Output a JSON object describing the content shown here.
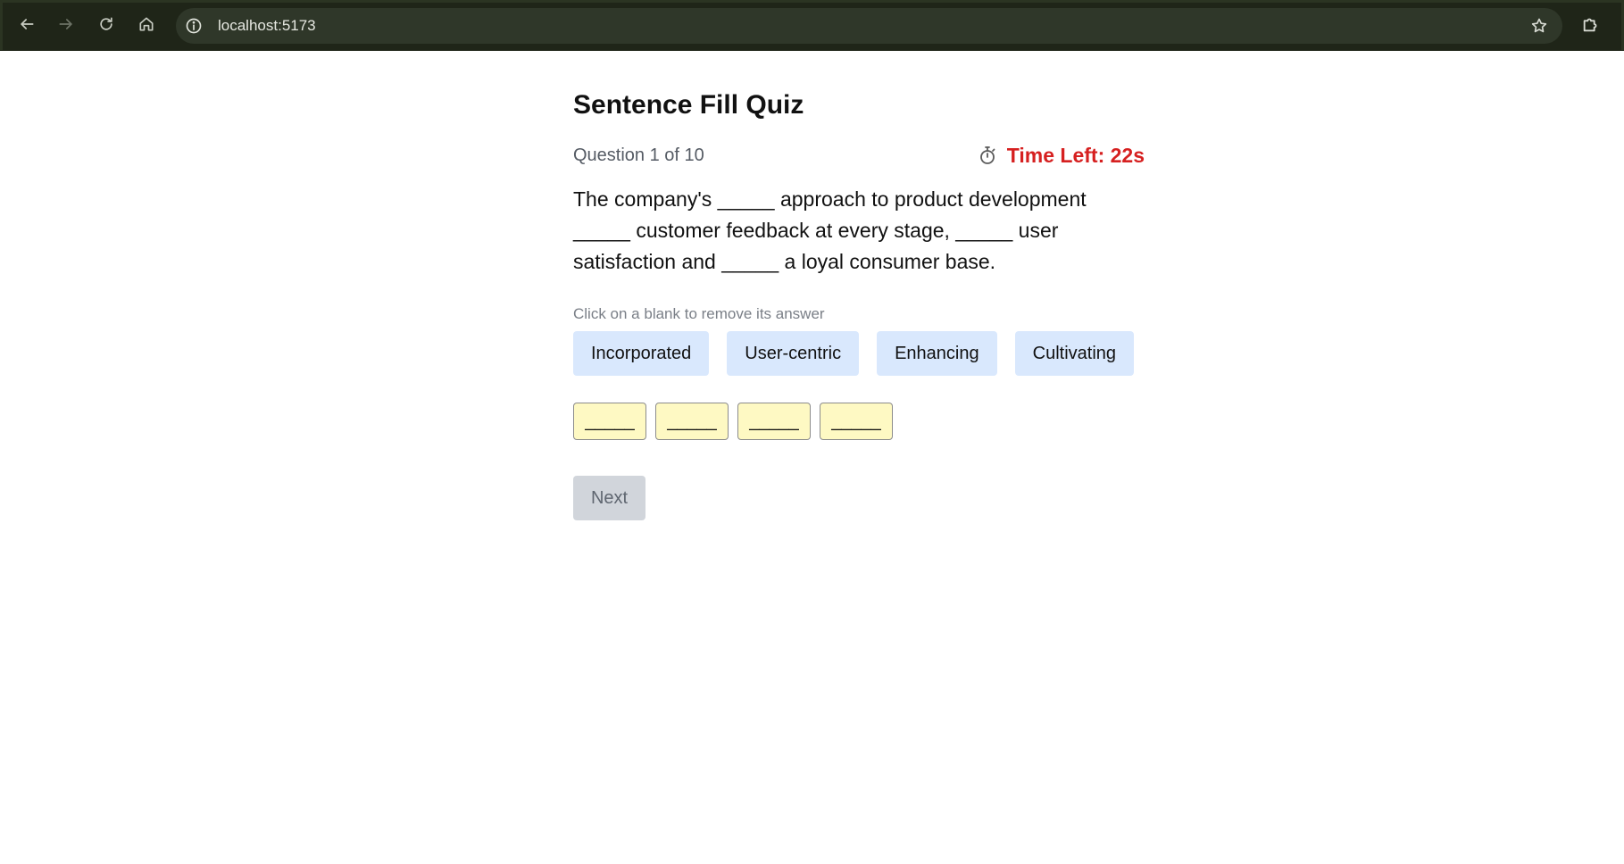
{
  "browser": {
    "url": "localhost:5173",
    "icons": {
      "back": "arrow-left-icon",
      "forward": "arrow-right-icon",
      "reload": "reload-icon",
      "home": "home-icon",
      "site_info": "info-icon",
      "bookmark": "star-icon",
      "extensions": "puzzle-icon"
    }
  },
  "quiz": {
    "title": "Sentence Fill Quiz",
    "question_counter": "Question 1 of 10",
    "timer_text": "Time Left: 22s",
    "timer_icon": "stopwatch-icon",
    "sentence": "The company's _____ approach to product development _____ customer feedback at every stage, _____ user satisfaction and _____ a loyal consumer base.",
    "hint": "Click on a blank to remove its answer",
    "options": [
      "Incorporated",
      "User-centric",
      "Enhancing",
      "Cultivating"
    ],
    "blanks": [
      "_____",
      "_____",
      "_____",
      "_____"
    ],
    "next_label": "Next"
  },
  "colors": {
    "timer": "#d62020",
    "option_bg": "#d9e8fd",
    "blank_bg": "#fef9c3",
    "next_disabled_bg": "#d1d5db",
    "browser_bar": "#1f2518"
  }
}
